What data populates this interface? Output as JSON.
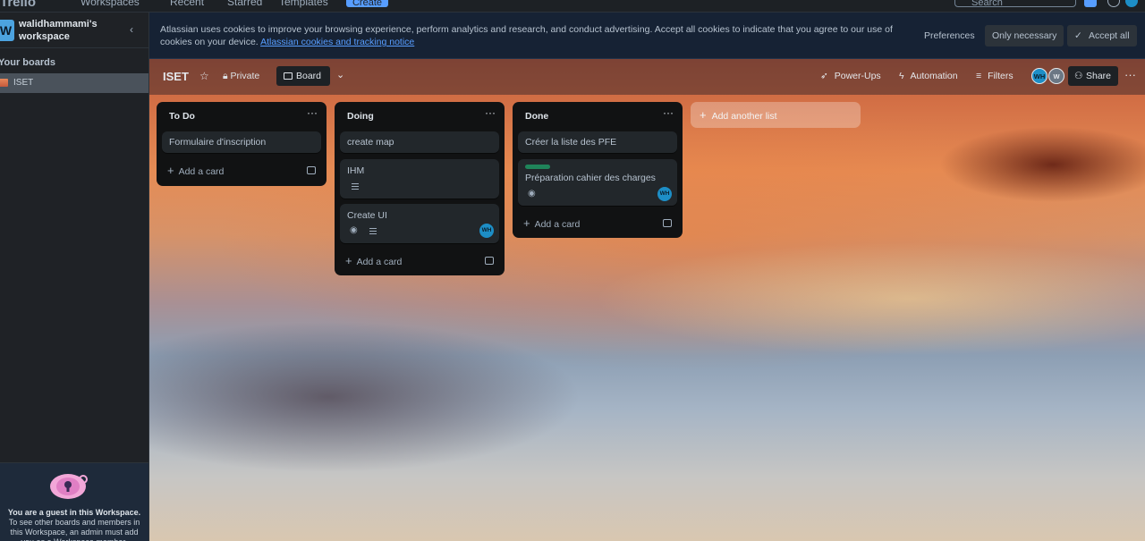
{
  "topnav": {
    "logo": "Trello",
    "items": [
      "Workspaces",
      "Recent",
      "Starred",
      "Templates"
    ],
    "create_label": "Create",
    "search_placeholder": "Search"
  },
  "sidebar": {
    "workspace_initial": "W",
    "workspace_name": "walidhammami's workspace",
    "section_title": "Your boards",
    "boards": [
      {
        "label": "ISET"
      }
    ],
    "guest": {
      "title": "You are a guest in this Workspace.",
      "text": "To see other boards and members in this Workspace, an admin must add you as a Workspace member."
    }
  },
  "cookie_banner": {
    "text": "Atlassian uses cookies to improve your browsing experience, perform analytics and research, and conduct advertising. Accept all cookies to indicate that you agree to our use of cookies on your device.",
    "link": "Atlassian cookies and tracking notice",
    "preferences": "Preferences",
    "only_necessary": "Only necessary",
    "accept_all": "Accept all"
  },
  "board_header": {
    "title": "ISET",
    "visibility": "Private",
    "view": "Board",
    "powerups": "Power-Ups",
    "automation": "Automation",
    "filters": "Filters",
    "avatars": [
      "WH",
      "W"
    ],
    "share": "Share"
  },
  "lists": [
    {
      "title": "To Do",
      "cards": [
        {
          "title": "Formulaire d'inscription"
        }
      ],
      "add_card": "Add a card"
    },
    {
      "title": "Doing",
      "cards": [
        {
          "title": "create map"
        },
        {
          "title": "IHM"
        },
        {
          "title": "Create UI",
          "member": "WH"
        }
      ],
      "add_card": "Add a card"
    },
    {
      "title": "Done",
      "cards": [
        {
          "title": "Créer la liste des PFE"
        },
        {
          "title": "Préparation cahier des charges",
          "member": "WH",
          "label_color": "#1f845a"
        }
      ],
      "add_card": "Add a card"
    }
  ],
  "add_list": "Add another list",
  "colors": {
    "accent": "#579dff",
    "member": "#1d8ec6"
  }
}
